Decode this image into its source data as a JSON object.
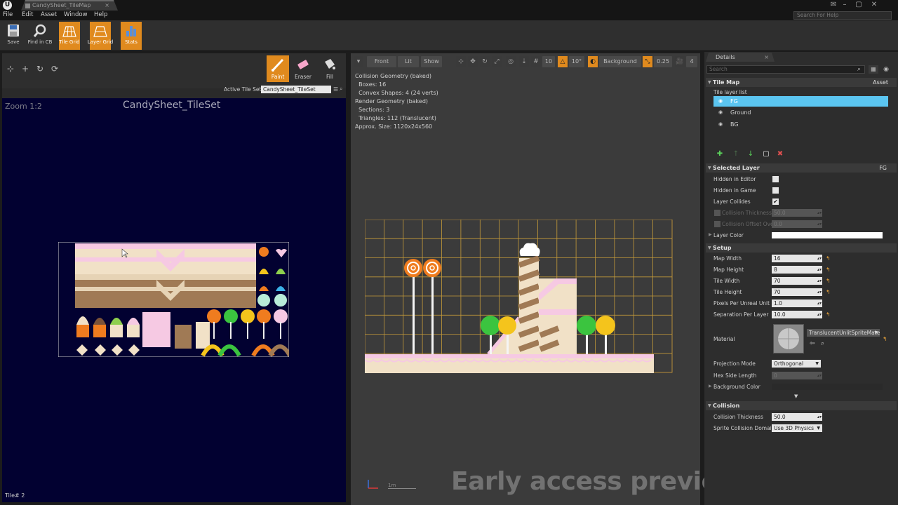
{
  "titlebar": {
    "tab_label": "CandySheet_TileMap",
    "help_search_placeholder": "Search For Help"
  },
  "menu": [
    "File",
    "Edit",
    "Asset",
    "Window",
    "Help"
  ],
  "toolbar": [
    {
      "label": "Save",
      "icon": "save-icon",
      "active": false
    },
    {
      "label": "Find in CB",
      "icon": "find-icon",
      "active": false
    },
    {
      "label": "Tile Grid",
      "icon": "tile-grid-icon",
      "active": true
    },
    {
      "label": "Layer Grid",
      "icon": "layer-grid-icon",
      "active": true
    },
    {
      "label": "Stats",
      "icon": "stats-icon",
      "active": true
    }
  ],
  "tileset_panel": {
    "tools": [
      {
        "label": "Paint",
        "active": true
      },
      {
        "label": "Eraser",
        "active": false
      },
      {
        "label": "Fill",
        "active": false
      }
    ],
    "active_tileset_label": "Active Tile Set",
    "active_tileset_value": "CandySheet_TileSet",
    "zoom": "Zoom 1:2",
    "title": "CandySheet_TileSet",
    "tile_number": "Tile# 2"
  },
  "viewport": {
    "buttons": {
      "front": "Front",
      "lit": "Lit",
      "show": "Show",
      "grid_snap": "10",
      "rot_snap": "10°",
      "layer": "Background",
      "scale_snap": "0.25",
      "cam_speed": "4"
    },
    "stats": [
      "Collision Geometry (baked)",
      "  Boxes: 16",
      "  Convex Shapes: 4 (24 verts)",
      "Render Geometry (baked)",
      "  Sections: 3",
      "  Triangles: 112 (Translucent)",
      "Approx. Size: 1120x24x560"
    ],
    "scale_label": "1m",
    "watermark": "Early access preview"
  },
  "details": {
    "tab_label": "Details",
    "search_placeholder": "Search",
    "tile_map_section": "Tile Map",
    "tile_map_asset": "Asset",
    "tile_layer_list_label": "Tile layer list",
    "layers": [
      {
        "name": "FG",
        "selected": true
      },
      {
        "name": "Ground",
        "selected": false
      },
      {
        "name": "BG",
        "selected": false
      }
    ],
    "selected_layer_section": "Selected Layer",
    "selected_layer_value": "FG",
    "selected_layer_props": [
      {
        "label": "Hidden in Editor",
        "checked": false
      },
      {
        "label": "Hidden in Game",
        "checked": false
      },
      {
        "label": "Layer Collides",
        "checked": true
      }
    ],
    "collision_thickness_override_label": "Collision Thickness",
    "collision_thickness_override_value": "50.0",
    "collision_offset_override_label": "Collision Offset Ove",
    "collision_offset_override_value": "0.0",
    "layer_color_label": "Layer Color",
    "setup_section": "Setup",
    "setup_props": [
      {
        "label": "Map Width",
        "value": "16"
      },
      {
        "label": "Map Height",
        "value": "8"
      },
      {
        "label": "Tile Width",
        "value": "70"
      },
      {
        "label": "Tile Height",
        "value": "70"
      },
      {
        "label": "Pixels Per Unreal Unit",
        "value": "1.0"
      },
      {
        "label": "Separation Per Layer",
        "value": "10.0"
      }
    ],
    "material_label": "Material",
    "material_value": "TranslucentUnlitSpriteMate",
    "projection_mode_label": "Projection Mode",
    "projection_mode_value": "Orthogonal",
    "hex_side_length_label": "Hex Side Length",
    "hex_side_length_value": "0",
    "background_color_label": "Background Color",
    "collision_section": "Collision",
    "collision_thickness_label": "Collision Thickness",
    "collision_thickness_value": "50.0",
    "sprite_collision_domain_label": "Sprite Collision Domain",
    "sprite_collision_domain_value": "Use 3D Physics"
  },
  "colors": {
    "accent_orange": "#e08a1e",
    "selected_layer_blue": "#5bc5f0",
    "tileset_bg": "#020131",
    "viewport_bg": "#3b3b3b",
    "grid_gold": "#d8a23a",
    "candy_pink": "#f6c9e3",
    "candy_cream": "#f1e1c7"
  }
}
